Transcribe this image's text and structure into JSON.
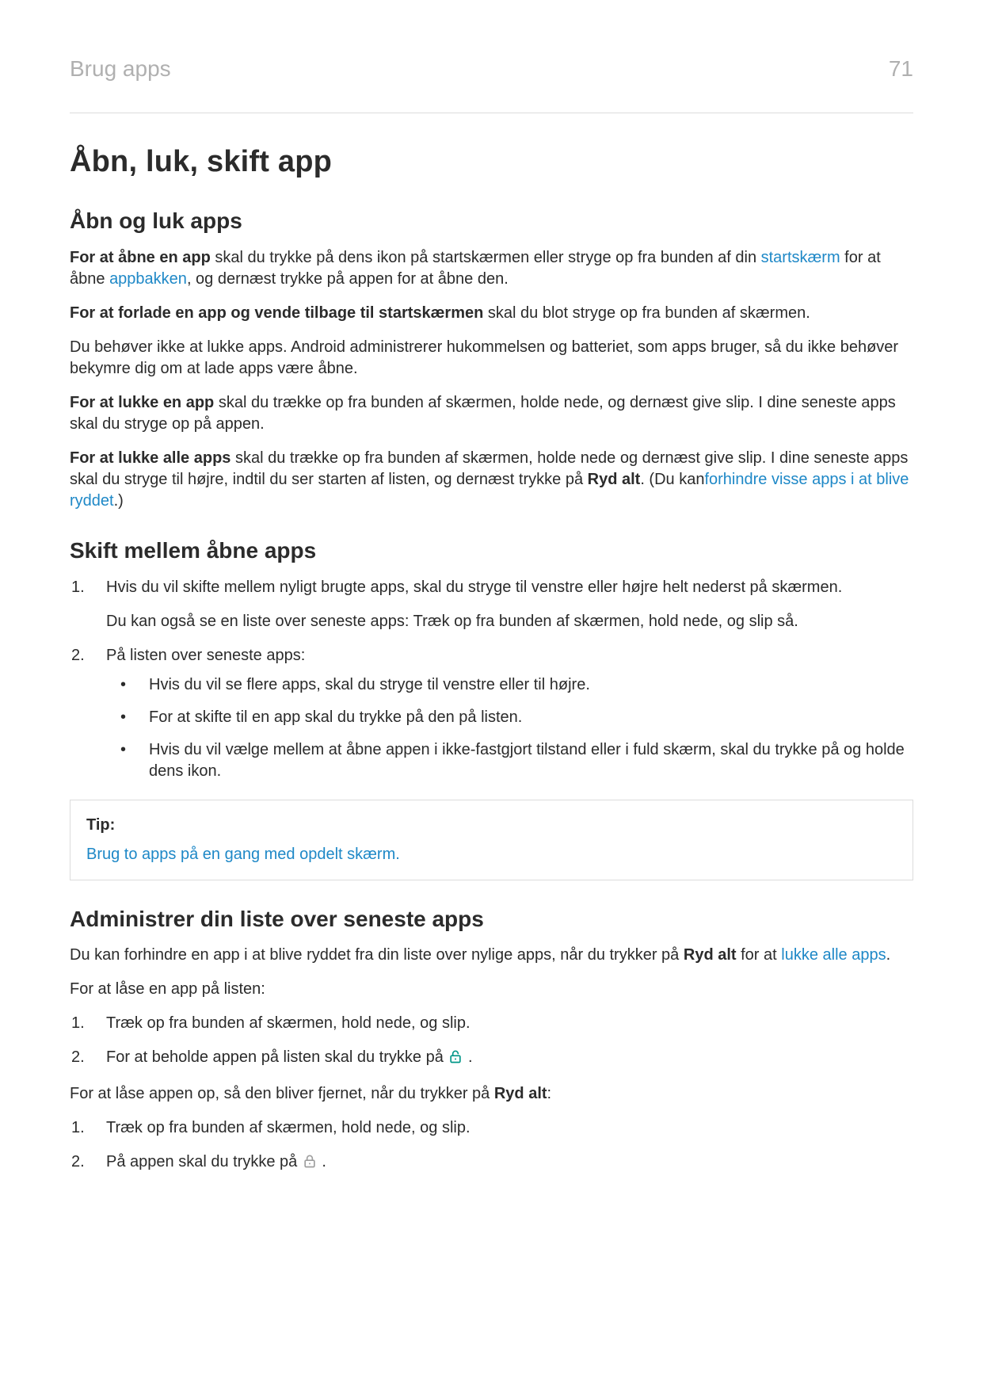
{
  "header": {
    "section": "Brug apps",
    "page_number": "71"
  },
  "title": "Åbn, luk, skift app",
  "s1": {
    "heading": "Åbn og luk apps",
    "p1": {
      "b": "For at åbne en app",
      "t1": " skal du trykke på dens ikon på startskærmen eller stryge op fra bunden af din ",
      "link1": "startskærm",
      "t2": " for at åbne ",
      "link2": "appbakken",
      "t3": ", og dernæst trykke på appen for at åbne den."
    },
    "p2": {
      "b": "For at forlade en app og vende tilbage til startskærmen",
      "t": " skal du blot stryge op fra bunden af skærmen."
    },
    "p3": "Du behøver ikke at lukke apps. Android administrerer hukommelsen og batteriet, som apps bruger, så du ikke behøver bekymre dig om at lade apps være åbne.",
    "p4": {
      "b": "For at lukke en app",
      "t": " skal du trække op fra bunden af skærmen, holde nede, og dernæst give slip. I dine seneste apps skal du stryge op på appen."
    },
    "p5": {
      "b": "For at lukke alle apps",
      "t1": " skal du trække op fra bunden af skærmen, holde nede og dernæst give slip. I dine seneste apps skal du stryge til højre, indtil du ser starten af listen, og dernæst trykke på ",
      "b2": "Ryd alt",
      "t2": ". (Du kan",
      "link": "forhindre visse apps i at blive ryddet",
      "t3": ".)"
    }
  },
  "s2": {
    "heading": "Skift mellem åbne apps",
    "li1a": "Hvis du vil skifte mellem nyligt brugte apps, skal du stryge til venstre eller højre helt nederst på skærmen.",
    "li1b": "Du kan også se en liste over seneste apps: Træk op fra bunden af skærmen, hold nede, og slip så.",
    "li2_intro": "På listen over seneste apps:",
    "li2a": "Hvis du vil se flere apps, skal du stryge til venstre eller til højre.",
    "li2b": "For at skifte til en app skal du trykke på den på listen.",
    "li2c": "Hvis du vil vælge mellem at åbne appen i ikke-fastgjort tilstand eller i fuld skærm, skal du trykke på og holde dens ikon."
  },
  "tip": {
    "label": "Tip:",
    "text": "Brug to apps på en gang med opdelt skærm."
  },
  "s3": {
    "heading": "Administrer din liste over seneste apps",
    "intro": {
      "t1": "Du kan forhindre en app i at blive ryddet fra din liste over nylige apps, når du trykker på ",
      "b": "Ryd alt",
      "t2": " for at ",
      "link": "lukke alle apps",
      "t3": "."
    },
    "lock_intro": "For at låse en app på listen:",
    "lock1": "Træk op fra bunden af skærmen, hold nede, og slip.",
    "lock2a": "For at beholde appen på listen skal du trykke på ",
    "lock2b": ".",
    "unlock_intro_a": "For at låse appen op, så den bliver fjernet, når du trykker på ",
    "unlock_b": "Ryd alt",
    "unlock_intro_b": ":",
    "unlock1": "Træk op fra bunden af skærmen, hold nede, og slip.",
    "unlock2a": "På appen skal du trykke på ",
    "unlock2b": "."
  },
  "markers": {
    "n1": "1.",
    "n2": "2."
  }
}
